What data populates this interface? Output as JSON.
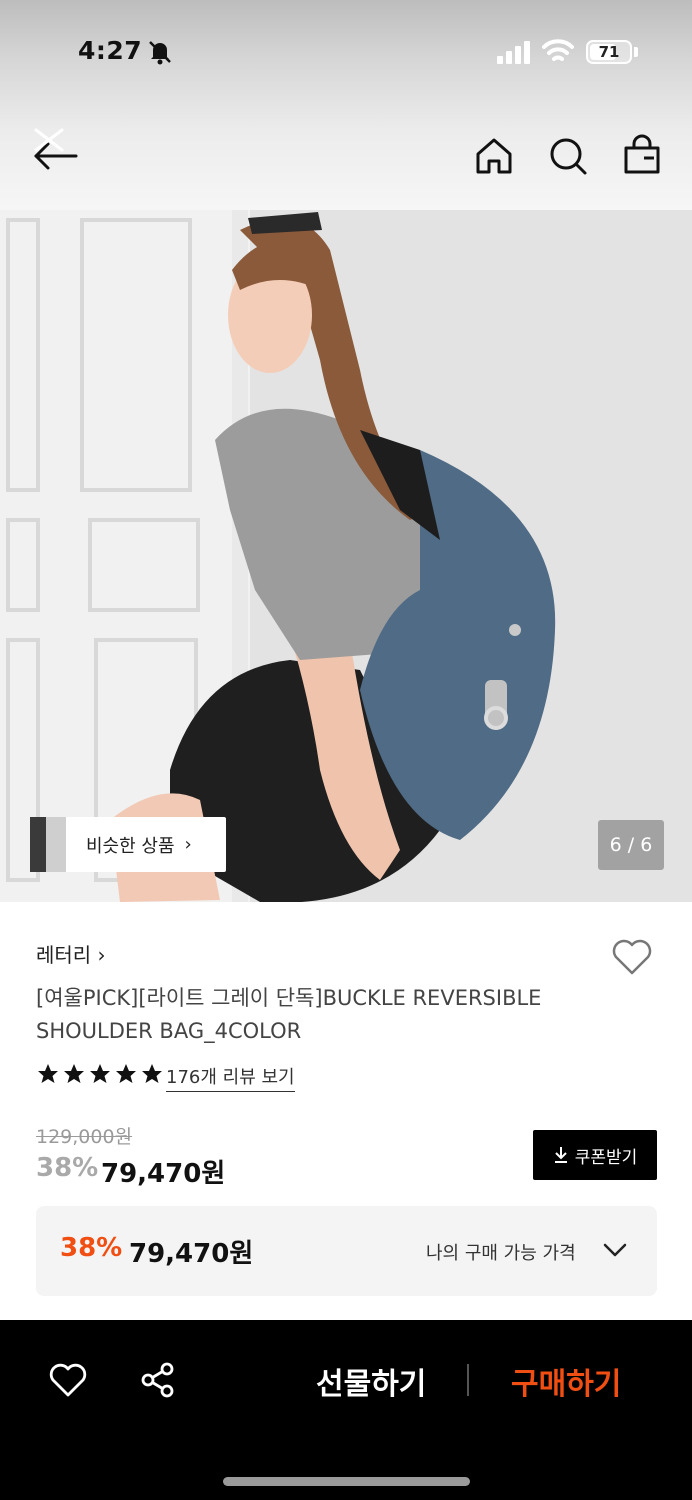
{
  "status_bar": {
    "time": "4:27",
    "battery": "71",
    "battery_level": 0.71
  },
  "header": {
    "back_icon": "back-arrow-icon",
    "home_icon": "home-icon",
    "search_icon": "search-icon",
    "cart_icon": "shopping-bag-icon"
  },
  "gallery": {
    "similar_label": "비슷한 상품",
    "similar_chevron": "›",
    "page_counter": "6 / 6"
  },
  "product": {
    "brand": "레터리 ›",
    "title": "[여울PICK][라이트 그레이 단독]BUCKLE REVERSIBLE SHOULDER BAG_4COLOR",
    "rating": 5,
    "review_link": "176개 리뷰 보기",
    "original_price": "129,000원",
    "discount_rate": "38%",
    "sale_price": "79,470원",
    "coupon_label": "쿠폰받기"
  },
  "my_price": {
    "rate": "38%",
    "price": "79,470원",
    "label": "나의 구매 가능 가격"
  },
  "bottom_bar": {
    "gift_label": "선물하기",
    "buy_label": "구매하기"
  },
  "colors": {
    "accent_orange": "#f04e12",
    "bar_black": "#000000",
    "bag_blue": "#4f6b85"
  }
}
